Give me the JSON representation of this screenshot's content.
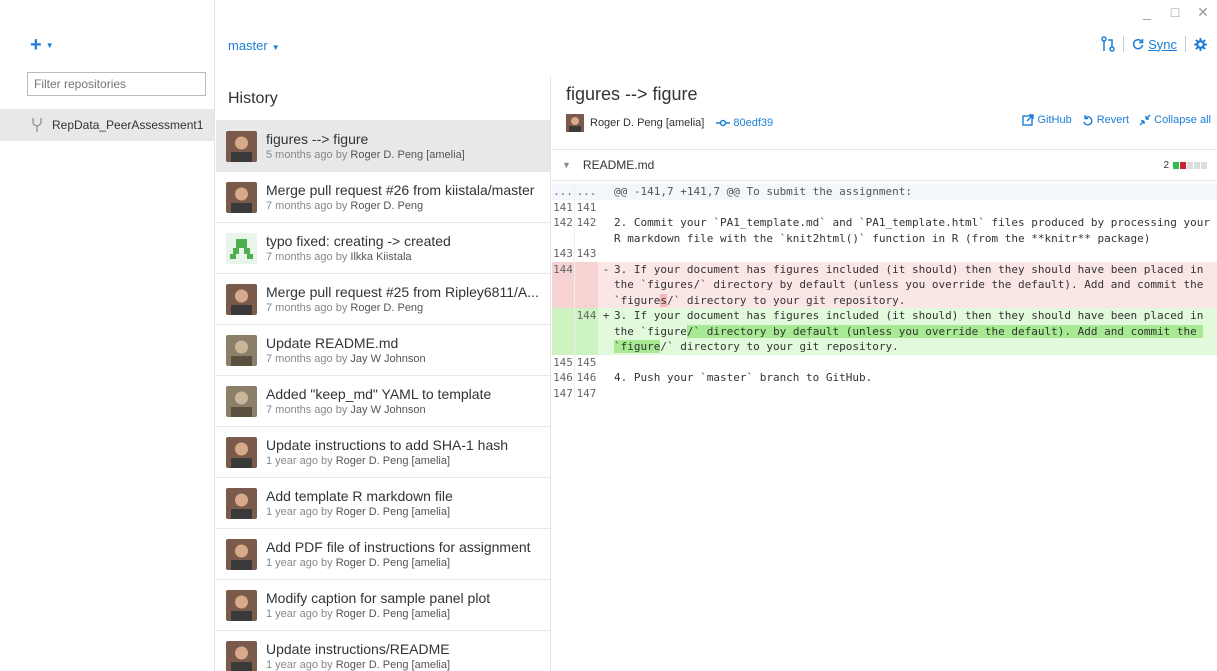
{
  "window": {
    "minimize": "_",
    "maximize": "□",
    "close": "✕"
  },
  "sidebar": {
    "add_label": "+",
    "filter_placeholder": "Filter repositories",
    "repos": [
      {
        "name": "RepData_PeerAssessment1"
      }
    ]
  },
  "topbar": {
    "branch": "master",
    "sync_label": "Sync"
  },
  "history": {
    "title": "History",
    "commits": [
      {
        "message": "figures --> figure",
        "time": "5 months ago by",
        "author": "Roger D. Peng [amelia]"
      },
      {
        "message": "Merge pull request #26 from kiistala/master",
        "time": "7 months ago by",
        "author": "Roger D. Peng"
      },
      {
        "message": "typo fixed: creating -> created",
        "time": "7 months ago by",
        "author": "Ilkka Kiistala"
      },
      {
        "message": "Merge pull request #25 from Ripley6811/A...",
        "time": "7 months ago by",
        "author": "Roger D. Peng"
      },
      {
        "message": "Update README.md",
        "time": "7 months ago by",
        "author": "Jay W Johnson"
      },
      {
        "message": "Added \"keep_md\" YAML to template",
        "time": "7 months ago by",
        "author": "Jay W Johnson"
      },
      {
        "message": "Update instructions to add SHA-1 hash",
        "time": "1 year ago by",
        "author": "Roger D. Peng [amelia]"
      },
      {
        "message": "Add template R markdown file",
        "time": "1 year ago by",
        "author": "Roger D. Peng [amelia]"
      },
      {
        "message": "Add PDF file of instructions for assignment",
        "time": "1 year ago by",
        "author": "Roger D. Peng [amelia]"
      },
      {
        "message": "Modify caption for sample panel plot",
        "time": "1 year ago by",
        "author": "Roger D. Peng [amelia]"
      },
      {
        "message": "Update instructions/README",
        "time": "1 year ago by",
        "author": "Roger D. Peng [amelia]"
      }
    ]
  },
  "detail": {
    "title": "figures --> figure",
    "author": "Roger D. Peng [amelia]",
    "sha": "80edf39",
    "actions": {
      "github": "GitHub",
      "revert": "Revert",
      "collapse": "Collapse all"
    },
    "file": {
      "name": "README.md",
      "changes": "2"
    },
    "diff": {
      "hunk": {
        "l1": "...",
        "l2": "...",
        "code": "@@ -141,7 +141,7 @@ To submit the assignment:"
      },
      "l141": {
        "l1": "141",
        "l2": "141",
        "code": ""
      },
      "l142": {
        "l1": "142",
        "l2": "142",
        "code": "2. Commit your `PA1_template.md` and `PA1_template.html` files produced by processing your R markdown file with the `knit2html()` function in R (from the **knitr** package)"
      },
      "l143": {
        "l1": "143",
        "l2": "143",
        "code": ""
      },
      "del": {
        "l1": "144",
        "sign": "-",
        "pre": "3. If your document has figures included (it should) then they should have been placed in the `figures/` directory by default (unless you override the default). Add and commit the `figure",
        "hl": "s",
        "post": "/` directory to your git repository."
      },
      "add": {
        "l2": "144",
        "sign": "+",
        "pre": "3. If your document has figures included (it should) then they should have been placed in the `figure",
        "hl": "/` directory by default (unless you override the default). Add and commit the `figure",
        "post": "/` directory to your git repository."
      },
      "l145": {
        "l1": "145",
        "l2": "145",
        "code": ""
      },
      "l146": {
        "l1": "146",
        "l2": "146",
        "code": "4. Push your `master` branch to GitHub."
      },
      "l147": {
        "l1": "147",
        "l2": "147",
        "code": ""
      }
    }
  },
  "colors": {
    "accent": "#1c7ed6",
    "additions": "#2cbe4e",
    "deletions": "#cb2431"
  }
}
